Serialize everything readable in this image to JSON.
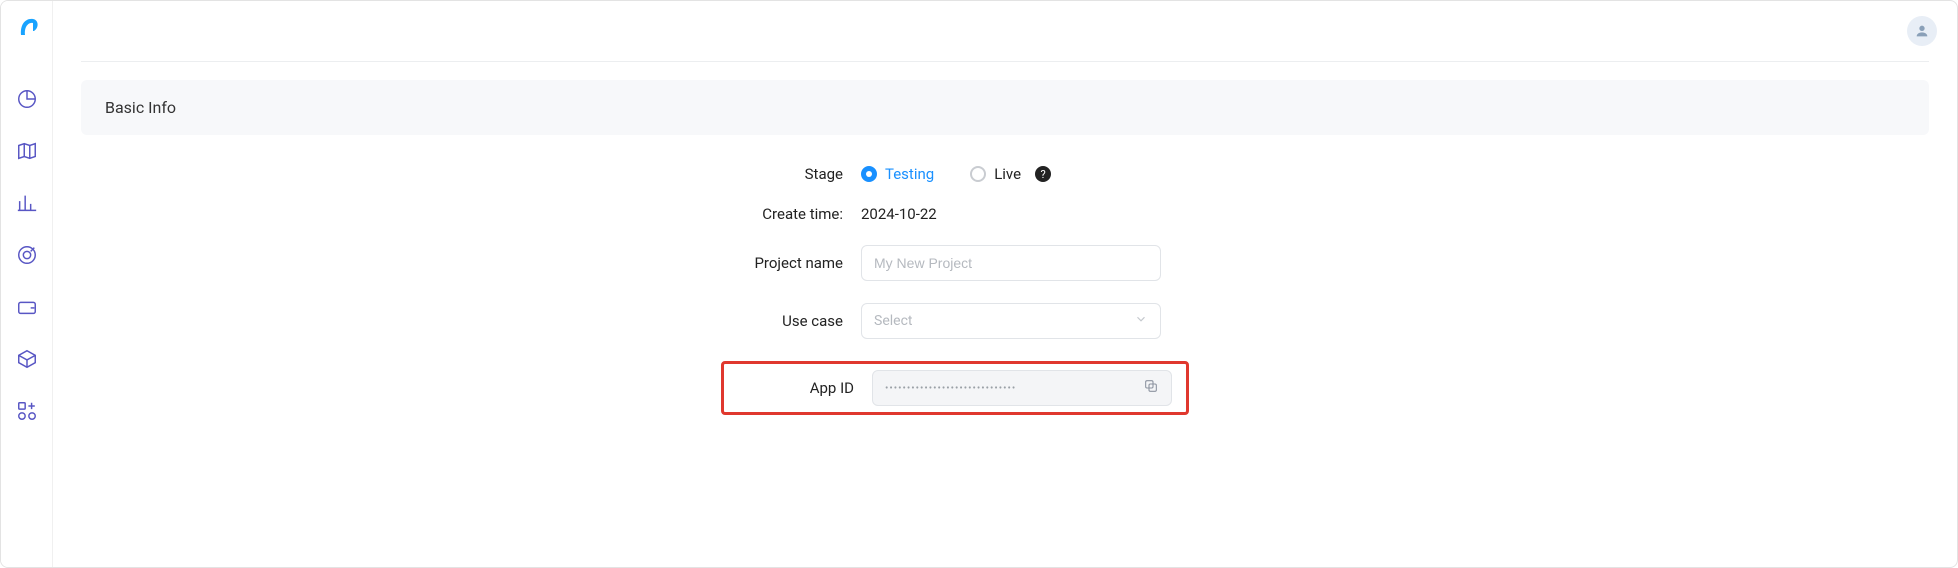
{
  "section": {
    "title": "Basic Info"
  },
  "form": {
    "stage": {
      "label": "Stage",
      "options": {
        "testing": "Testing",
        "live": "Live"
      },
      "selected": "testing"
    },
    "create_time": {
      "label": "Create time:",
      "value": "2024-10-22"
    },
    "project_name": {
      "label": "Project name",
      "placeholder": "My New Project",
      "value": ""
    },
    "use_case": {
      "label": "Use case",
      "placeholder": "Select"
    },
    "app_id": {
      "label": "App ID",
      "masked_value": "••••••••••••••••••••••••••••••"
    }
  },
  "icons": {
    "help": "?"
  }
}
